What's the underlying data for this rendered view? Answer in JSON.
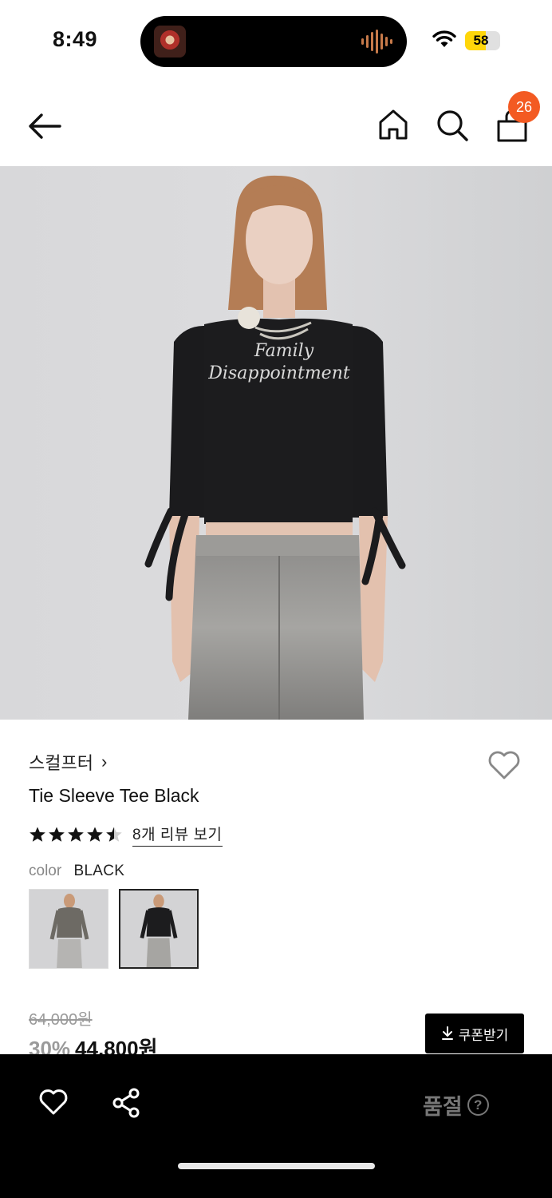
{
  "status_bar": {
    "time": "8:49",
    "battery": "58",
    "battery_level": 0.58
  },
  "nav": {
    "cart_count": "26",
    "icons": [
      "back-arrow-icon",
      "home-icon",
      "search-icon",
      "shopping-bag-icon"
    ]
  },
  "hero": {
    "shirt_text_line1": "Family",
    "shirt_text_line2": "Disappointment"
  },
  "product": {
    "brand": "스컬프터",
    "brand_chevron": "›",
    "name": "Tie Sleeve Tee Black",
    "rating": 4.5,
    "review_link": "8개 리뷰 보기",
    "color_label": "color",
    "color_value": "BLACK",
    "original_price": "64,000원",
    "discount": "30%",
    "sale_price": "44,800원",
    "coupon_label": "쿠폰받기",
    "coupon_icon": "download-icon"
  },
  "bottom_bar": {
    "soldout_label": "품절",
    "help_icon": "?"
  },
  "colors": {
    "accent_badge": "#f35a22",
    "battery": "#ffd60a",
    "bottom_bar": "#000000"
  }
}
